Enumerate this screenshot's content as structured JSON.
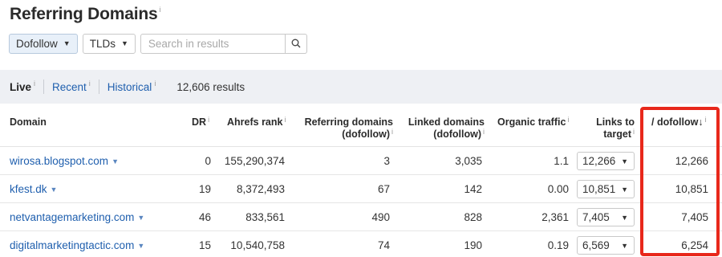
{
  "page": {
    "title": "Referring Domains",
    "title_info": "i"
  },
  "filters": {
    "link_type": "Dofollow",
    "tlds": "TLDs",
    "search_placeholder": "Search in results"
  },
  "tabs": [
    {
      "label": "Live",
      "info": "i"
    },
    {
      "label": "Recent",
      "info": "i"
    },
    {
      "label": "Historical",
      "info": "i"
    }
  ],
  "results_count": "12,606 results",
  "columns": {
    "domain": "Domain",
    "dr": "DR",
    "ahrefs_rank": "Ahrefs rank",
    "ref_domains_1": "Referring domains",
    "ref_domains_2": "(dofollow)",
    "linked_1": "Linked domains",
    "linked_2": "(dofollow)",
    "organic": "Organic traffic",
    "links_1": "Links to",
    "links_2": "target",
    "dofollow": "/ dofollow",
    "sort_arrow": "↓",
    "info": "i"
  },
  "rows": [
    {
      "domain": "wirosa.blogspot.com",
      "dr": "0",
      "ahrefs_rank": "155,290,374",
      "ref_domains": "3",
      "linked_domains": "3,035",
      "organic": "1.1",
      "links": "12,266",
      "dofollow": "12,266"
    },
    {
      "domain": "kfest.dk",
      "dr": "19",
      "ahrefs_rank": "8,372,493",
      "ref_domains": "67",
      "linked_domains": "142",
      "organic": "0.00",
      "links": "10,851",
      "dofollow": "10,851"
    },
    {
      "domain": "netvantagemarketing.com",
      "dr": "46",
      "ahrefs_rank": "833,561",
      "ref_domains": "490",
      "linked_domains": "828",
      "organic": "2,361",
      "links": "7,405",
      "dofollow": "7,405"
    },
    {
      "domain": "digitalmarketingtactic.com",
      "dr": "15",
      "ahrefs_rank": "10,540,758",
      "ref_domains": "74",
      "linked_domains": "190",
      "organic": "0.19",
      "links": "6,569",
      "dofollow": "6,254"
    }
  ],
  "colors": {
    "link": "#1f5fae",
    "highlight": "#e8281b",
    "tabs_bg": "#eef0f4"
  }
}
